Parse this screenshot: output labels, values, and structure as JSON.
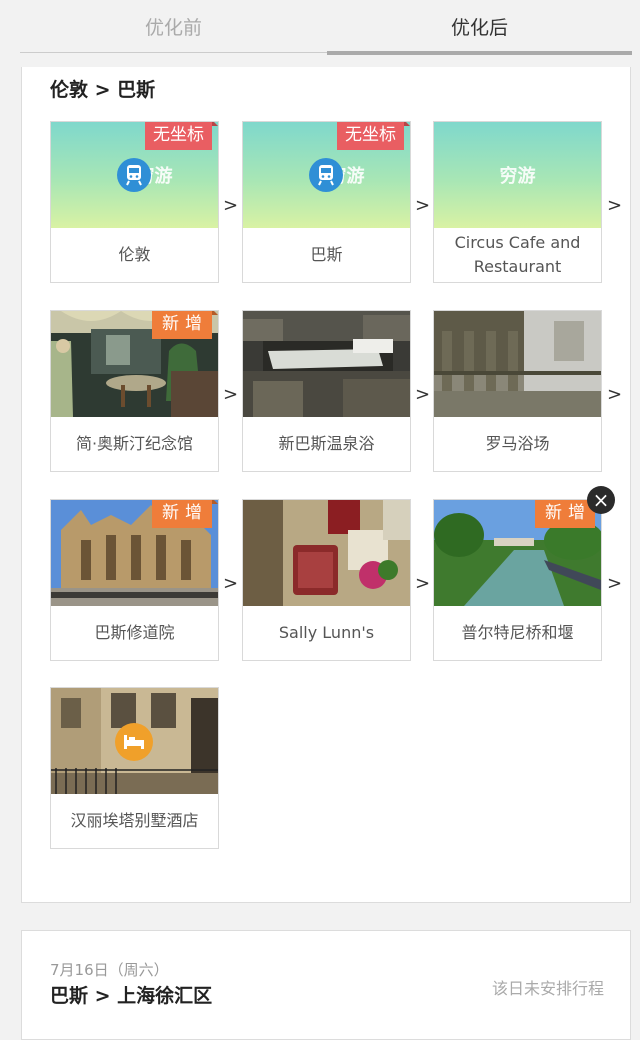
{
  "tabs": {
    "before": "优化前",
    "after": "优化后"
  },
  "day1": {
    "route": "伦敦 > 巴斯",
    "rows": [
      [
        {
          "caption": "伦敦",
          "badge": "无坐标",
          "badge_type": "red",
          "thumb": "placeholder",
          "icon": "train-icon"
        },
        {
          "caption": "巴斯",
          "badge": "无坐标",
          "badge_type": "red",
          "thumb": "placeholder",
          "icon": "train-icon"
        },
        {
          "caption": "Circus Cafe and Restaurant",
          "badge": "",
          "thumb": "placeholder",
          "icon": ""
        }
      ],
      [
        {
          "caption": "简·奥斯汀纪念馆",
          "badge": "新增",
          "badge_type": "orange",
          "thumb": "museum-interior"
        },
        {
          "caption": "新巴斯温泉浴",
          "badge": "",
          "thumb": "rooftop-spa"
        },
        {
          "caption": "罗马浴场",
          "badge": "",
          "thumb": "roman-baths"
        }
      ],
      [
        {
          "caption": "巴斯修道院",
          "badge": "新增",
          "badge_type": "orange",
          "thumb": "bath-abbey"
        },
        {
          "caption": "Sally Lunn's",
          "badge": "",
          "thumb": "sally-lunns"
        },
        {
          "caption": "普尔特尼桥和堰",
          "badge": "新增",
          "badge_type": "orange",
          "thumb": "pulteney-bridge"
        }
      ],
      [
        {
          "caption": "汉丽埃塔别墅酒店",
          "badge": "",
          "thumb": "hotel-building",
          "icon": "bed-icon"
        }
      ]
    ],
    "placeholder_logo": "穷游",
    "arrow": ">"
  },
  "day2": {
    "date": "7月16日（周六）",
    "route": "巴斯 > 上海徐汇区",
    "status": "该日未安排行程"
  },
  "colors": {
    "badge_red": "#e95e62",
    "badge_orange": "#ef7d3a",
    "train_icon": "#2f8fd6",
    "hotel_icon": "#f0a02a"
  }
}
